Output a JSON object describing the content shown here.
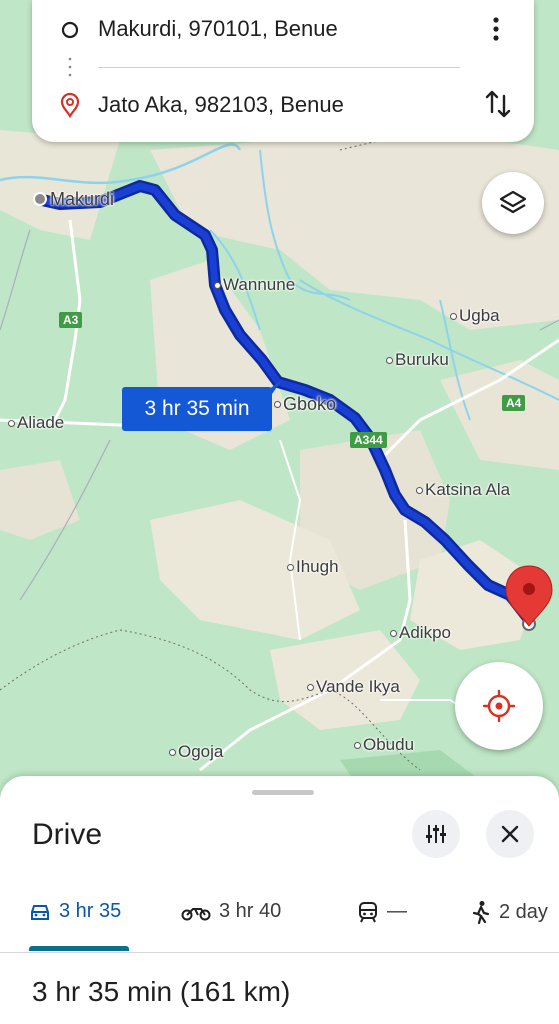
{
  "route": {
    "origin": "Makurdi, 970101, Benue",
    "destination": "Jato Aka, 982103, Benue",
    "eta_label": "3 hr 35 min"
  },
  "places": {
    "makurdi": "Makurdi",
    "wannune": "Wannune",
    "ugba": "Ugba",
    "buruku": "Buruku",
    "aliade": "Aliade",
    "gboko": "Gboko",
    "katsina_ala": "Katsina Ala",
    "ihugh": "Ihugh",
    "adikpo": "Adikpo",
    "vande_ikya": "Vande Ikya",
    "ogoja": "Ogoja",
    "obudu": "Obudu"
  },
  "highways": {
    "a3": "A3",
    "a4": "A4",
    "a344": "A344"
  },
  "sheet": {
    "title": "Drive",
    "modes": [
      {
        "icon": "car-icon",
        "label": "3 hr 35"
      },
      {
        "icon": "motorcycle-icon",
        "label": "3 hr 40"
      },
      {
        "icon": "train-icon",
        "label": "—"
      },
      {
        "icon": "walk-icon",
        "label": "2 day"
      }
    ],
    "summary": "3 hr 35 min (161 km)"
  },
  "colors": {
    "route": "#1a3fd4",
    "route_border": "#0d2a9c",
    "accent": "#0b57a6",
    "eta_box": "#1558d6",
    "pin": "#e53935"
  }
}
